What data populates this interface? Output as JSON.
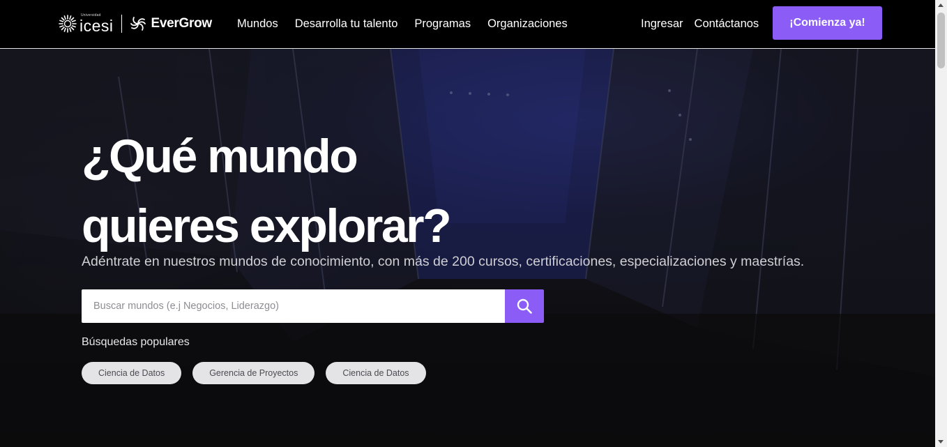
{
  "brand": {
    "university_small": "Universidad",
    "university": "icesi",
    "product": "EverGrow"
  },
  "nav": {
    "left_items": [
      "Mundos",
      "Desarrolla tu talento",
      "Programas",
      "Organizaciones"
    ],
    "right_items": [
      "Ingresar",
      "Contáctanos"
    ],
    "cta_label": "¡Comienza ya!"
  },
  "hero": {
    "title_line1": "¿Qué mundo",
    "title_line2": "quieres explorar?",
    "subtitle": "Adéntrate en nuestros mundos de conocimiento, con más de 200 cursos, certificaciones, especializaciones y maestrías."
  },
  "search": {
    "placeholder": "Buscar mundos (e.j Negocios, Liderazgo)",
    "value": "",
    "button_icon": "search-icon"
  },
  "popular": {
    "title": "Búsquedas populares",
    "chips": [
      "Ciencia de Datos",
      "Gerencia de Proyectos",
      "Ciencia de Datos"
    ]
  },
  "colors": {
    "accent": "#8b5cf6",
    "header_bg": "#000000",
    "hero_bg": "#101015",
    "chip_bg": "#e4e4e7"
  }
}
